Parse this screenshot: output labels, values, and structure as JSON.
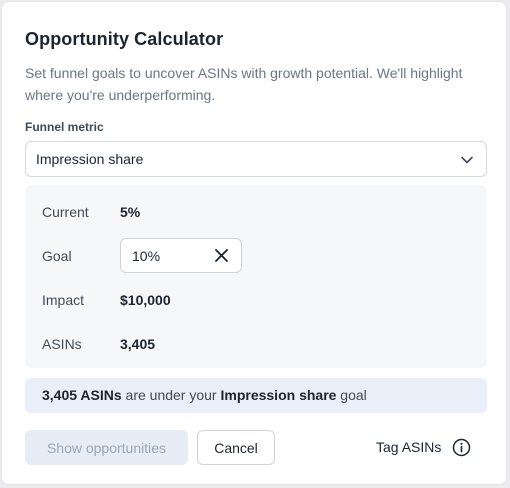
{
  "dialog": {
    "title": "Opportunity Calculator",
    "description": "Set funnel goals to uncover ASINs with growth potential. We'll highlight where you're underperforming."
  },
  "funnel": {
    "label": "Funnel metric",
    "selected": "Impression share"
  },
  "metrics": {
    "current_label": "Current",
    "current_value": "5%",
    "goal_label": "Goal",
    "goal_value": "10%",
    "impact_label": "Impact",
    "impact_value": "$10,000",
    "asins_label": "ASINs",
    "asins_value": "3,405"
  },
  "banner": {
    "count": "3,405 ASINs",
    "mid": " are under your ",
    "metric": "Impression share",
    "tail": " goal"
  },
  "actions": {
    "show_label": "Show opportunities",
    "cancel_label": "Cancel",
    "tag_label": "Tag ASINs"
  },
  "icons": {
    "dropdown": "chevron-down-icon",
    "clear": "close-icon",
    "info": "info-icon"
  },
  "colors": {
    "accent_disabled_bg": "#e6edf6",
    "banner_bg": "#e8eff8",
    "panel_bg": "#f6f7f8"
  }
}
